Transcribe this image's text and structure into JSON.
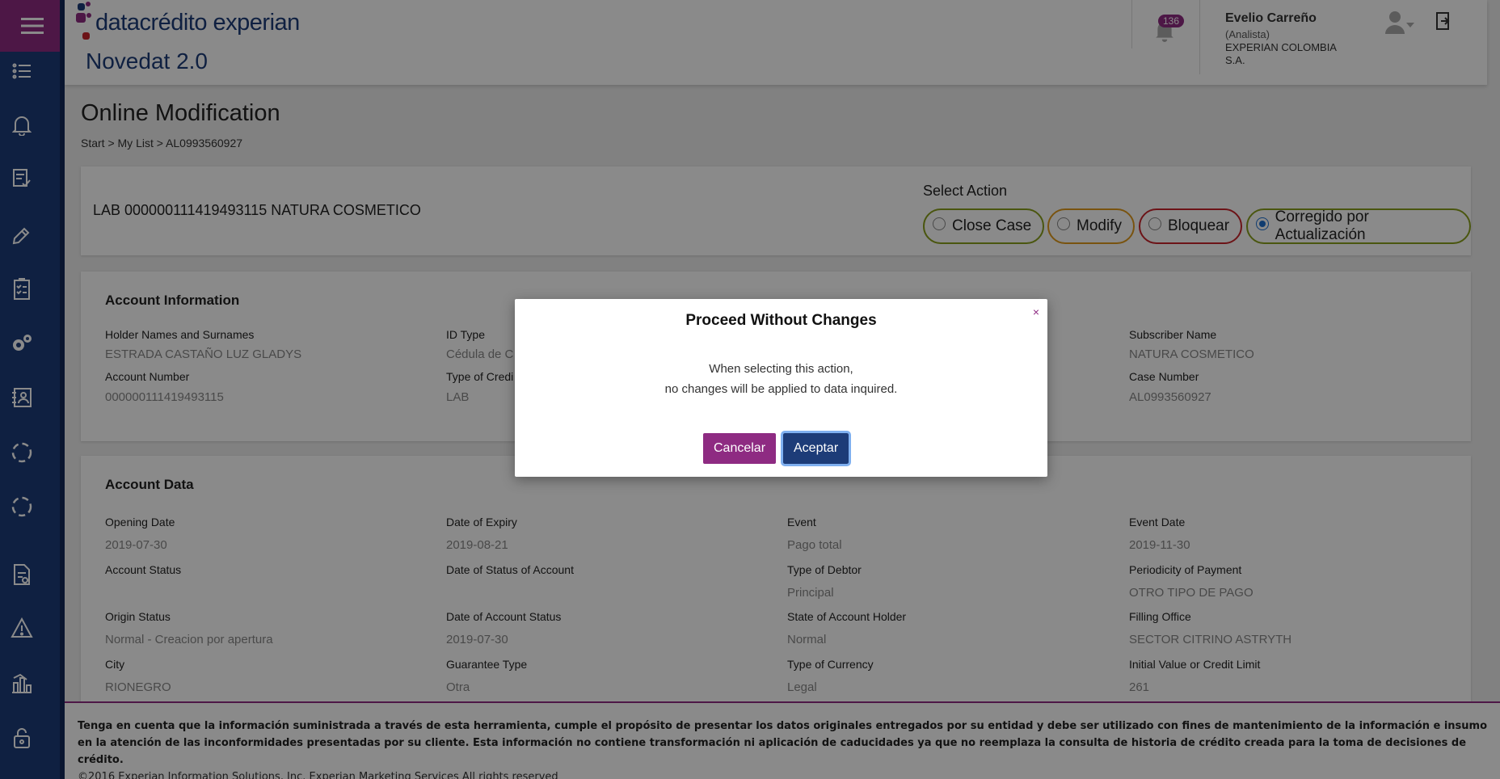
{
  "header": {
    "logo_text": "datacrédito experian",
    "app_name": "Novedat 2.0",
    "notification_count": "136",
    "user_name": "Evelio Carreño",
    "user_role": "(Analista)",
    "user_company": "EXPERIAN COLOMBIA S.A."
  },
  "sidebar": {
    "items": [
      "menu-icon",
      "list-icon",
      "bell-icon",
      "document-check-icon",
      "pencil-icon",
      "checklist-icon",
      "gears-icon",
      "contact-book-icon",
      "refresh-icon",
      "sync-icon",
      "report-icon",
      "warning-icon",
      "chart-icon",
      "lock-icon"
    ]
  },
  "page": {
    "title": "Online Modification",
    "breadcrumb": "Start > My List > AL0993560927"
  },
  "action_card": {
    "case_title": "LAB 000000111419493115 NATURA COSMETICO",
    "select_label": "Select Action",
    "options": [
      {
        "label": "Close Case",
        "color": "#8aa01d",
        "selected": false
      },
      {
        "label": "Modify",
        "color": "#e09a1d",
        "selected": false
      },
      {
        "label": "Bloquear",
        "color": "#c8242c",
        "selected": false
      },
      {
        "label": "Corregido por Actualización",
        "color": "#8aa01d",
        "selected": true
      }
    ]
  },
  "account_info": {
    "title": "Account Information",
    "fields": {
      "holder_label": "Holder Names and Surnames",
      "holder_value": "ESTRADA CASTAÑO LUZ GLADYS",
      "idtype_label": "ID Type",
      "idtype_value": "Cédula de C",
      "subscriber_label": "Subscriber Name",
      "subscriber_value": "NATURA COSMETICO",
      "account_number_label": "Account Number",
      "account_number_value": "000000111419493115",
      "credit_type_label": "Type of Credi",
      "credit_type_value": "LAB",
      "case_number_label": "Case Number",
      "case_number_value": "AL0993560927"
    }
  },
  "account_data": {
    "title": "Account Data",
    "rows": [
      [
        {
          "label": "Opening Date",
          "value": "2019-07-30"
        },
        {
          "label": "Date of Expiry",
          "value": "2019-08-21"
        },
        {
          "label": "Event",
          "value": "Pago total"
        },
        {
          "label": "Event Date",
          "value": "2019-11-30"
        }
      ],
      [
        {
          "label": "Account Status",
          "value": ""
        },
        {
          "label": "Date of Status of Account",
          "value": ""
        },
        {
          "label": "Type of Debtor",
          "value": "Principal"
        },
        {
          "label": "Periodicity of Payment",
          "value": "OTRO TIPO DE PAGO"
        }
      ],
      [
        {
          "label": "Origin Status",
          "value": "Normal - Creacion por apertura"
        },
        {
          "label": "Date of Account Status",
          "value": "2019-07-30"
        },
        {
          "label": "State of Account Holder",
          "value": "Normal"
        },
        {
          "label": "Filling Office",
          "value": "SECTOR CITRINO ASTRYTH"
        }
      ],
      [
        {
          "label": "City",
          "value": "RIONEGRO"
        },
        {
          "label": "Guarantee Type",
          "value": "Otra"
        },
        {
          "label": "Type of Currency",
          "value": "Legal"
        },
        {
          "label": "Initial Value or Credit Limit",
          "value": "261"
        }
      ]
    ]
  },
  "footer": {
    "disclaimer": "Tenga en cuenta que la información suministrada a través de esta herramienta, cumple el propósito de presentar los datos originales entregados por su entidad y debe ser utilizado con fines de mantenimiento de la información e insumo en la atención de las inconformidades presentadas por su cliente. Esta información no contiene transformación ni aplicación de caducidades ya que no reemplaza la consulta de historia de crédito creada para la toma de decisiones de crédito.",
    "copyright": "©2016 Experian Information Solutions, Inc. Experian Marketing Services All rights reserved"
  },
  "modal": {
    "title": "Proceed Without Changes",
    "close": "×",
    "message_line1": "When selecting this action,",
    "message_line2": "no changes will be applied to data inquired.",
    "cancel_label": "Cancelar",
    "accept_label": "Aceptar"
  },
  "colors": {
    "brand_navy": "#1d3c78",
    "brand_magenta": "#8e2b82"
  }
}
